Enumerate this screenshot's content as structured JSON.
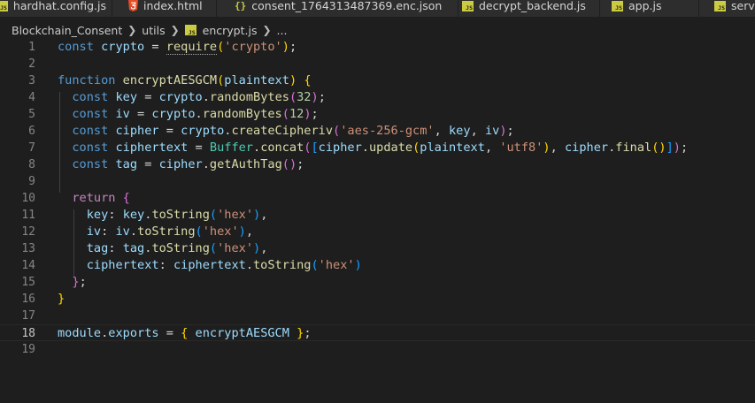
{
  "tabs": [
    {
      "label": "hardhat.config.js",
      "icon": "js-file-icon"
    },
    {
      "label": "index.html",
      "icon": "html-file-icon"
    },
    {
      "label": "consent_1764313487369.enc.json",
      "icon": "json-file-icon"
    },
    {
      "label": "decrypt_backend.js",
      "icon": "js-file-icon"
    },
    {
      "label": "app.js",
      "icon": "js-file-icon"
    },
    {
      "label": "serve",
      "icon": "js-file-icon"
    }
  ],
  "breadcrumb": {
    "folder1": "Blockchain_Consent",
    "folder2": "utils",
    "file": "encrypt.js",
    "symbol": "..."
  },
  "editor": {
    "active_line": 18,
    "line_numbers": [
      "1",
      "2",
      "3",
      "4",
      "5",
      "6",
      "7",
      "8",
      "9",
      "10",
      "11",
      "12",
      "13",
      "14",
      "15",
      "16",
      "17",
      "18",
      "19"
    ],
    "lines": [
      "const crypto = require('crypto');",
      "",
      "function encryptAESGCM(plaintext) {",
      "  const key = crypto.randomBytes(32);",
      "  const iv = crypto.randomBytes(12);",
      "  const cipher = crypto.createCipheriv('aes-256-gcm', key, iv);",
      "  const ciphertext = Buffer.concat([cipher.update(plaintext, 'utf8'), cipher.final()]);",
      "  const tag = cipher.getAuthTag();",
      "",
      "  return {",
      "    key: key.toString('hex'),",
      "    iv: iv.toString('hex'),",
      "    tag: tag.toString('hex'),",
      "    ciphertext: ciphertext.toString('hex')",
      "  };",
      "}",
      "",
      "module.exports = { encryptAESGCM };",
      ""
    ]
  },
  "colors": {
    "editor_bg": "#1e1e1e",
    "tabbar_bg": "#252526",
    "keyword": "#569cd6",
    "variable": "#9cdcfe",
    "function": "#dcdcaa",
    "string": "#ce9178",
    "number": "#b5cea8"
  }
}
